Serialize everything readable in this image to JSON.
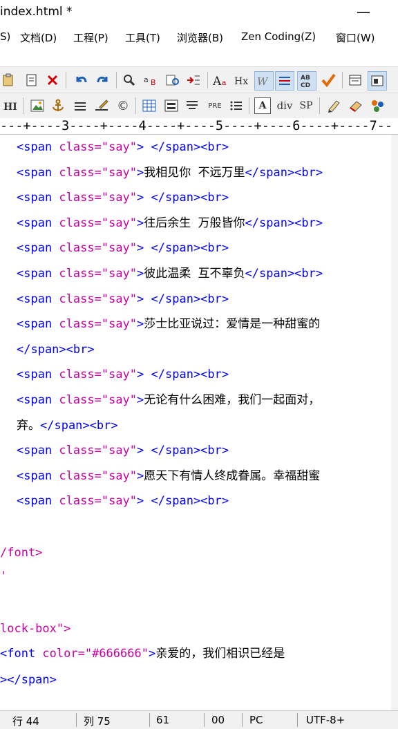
{
  "window": {
    "title": "index.html *",
    "minimize_glyph": "—"
  },
  "menu": {
    "items": [
      "S)",
      "文档(D)",
      "工程(P)",
      "工具(T)",
      "浏览器(B)",
      "Zen Coding(Z)",
      "窗口(W)"
    ]
  },
  "toolbar1": {
    "icons": [
      "paste-icon",
      "clipboard-icon",
      "delete-icon",
      "undo-icon",
      "redo-icon",
      "find-icon",
      "replace-icon",
      "find-in-files-icon",
      "indent-icon",
      "font-size-icon",
      "heading-icon",
      "word-wrap-icon",
      "paragraph-icon",
      "sort-icon",
      "check-icon",
      "view-icon",
      "layout-icon"
    ],
    "glyphs": {
      "heading": "Hx",
      "font_size": "Aa",
      "sort": "AB CD"
    }
  },
  "toolbar2": {
    "labels": {
      "h": "HI",
      "pre": "PRE",
      "div": "div",
      "sp": "SP",
      "a": "A",
      "copy": "©"
    }
  },
  "ruler": {
    "text": "---+----3----+----4----+----5----+----6----+----7--"
  },
  "code": {
    "tag_open": "<span",
    "attr_name": " class=",
    "attr_value": "\"say\"",
    "tag_gt": ">",
    "close_br": "</span><br>",
    "lines": [
      " ",
      "我相见你 不远万里",
      " ",
      "往后余生 万般皆你",
      " ",
      "彼此温柔 互不辜负",
      " ",
      "莎士比亚说过：爱情是一种甜蜜的",
      " ",
      "无论有什么困难，我们一起面对，",
      " ",
      "愿天下有情人终成眷属。幸福甜蜜",
      " "
    ],
    "cont1": "</span><br>",
    "cont2_text": "弃。",
    "cont2_tail": "</span><br>",
    "font_close": "/font>",
    "tick": "'",
    "lock_box": "lock-box\">",
    "font_open": "<font",
    "font_attr": " color=",
    "font_val": "\"#666666\"",
    "font_text": "亲爱的，我们相识已经是",
    "last_close": "></span>"
  },
  "status": {
    "line": "行 44",
    "col": "列 75",
    "chars": "61",
    "code": "00",
    "format": "PC",
    "encoding": "UTF-8+"
  },
  "colors": {
    "tag": "#0000ff",
    "attr": "#c800a4",
    "text": "#000000"
  }
}
